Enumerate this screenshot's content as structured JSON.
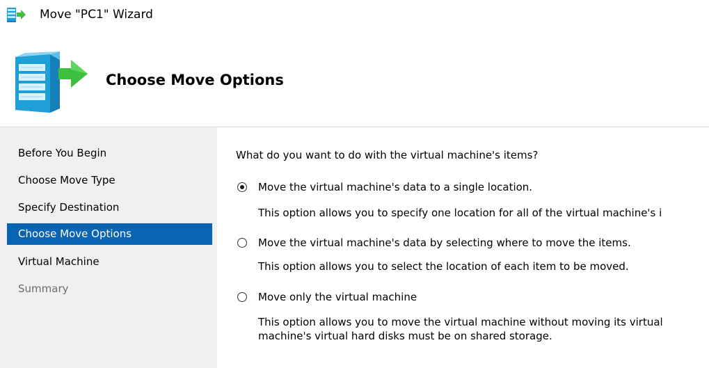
{
  "window": {
    "title": "Move \"PC1\" Wizard"
  },
  "header": {
    "title": "Choose Move Options"
  },
  "nav": {
    "items": [
      {
        "label": "Before You Begin",
        "state": "normal"
      },
      {
        "label": "Choose Move Type",
        "state": "normal"
      },
      {
        "label": "Specify Destination",
        "state": "normal"
      },
      {
        "label": "Choose Move Options",
        "state": "selected"
      },
      {
        "label": "Virtual Machine",
        "state": "normal"
      },
      {
        "label": "Summary",
        "state": "disabled"
      }
    ]
  },
  "content": {
    "question": "What do you want to do with the virtual machine's items?",
    "options": [
      {
        "label": "Move the virtual machine's data to a single location.",
        "description_line1": "This option allows you to specify one location for all of the virtual machine's i",
        "description_line2": "",
        "checked": true
      },
      {
        "label": "Move the virtual machine's data by selecting where to move the items.",
        "description_line1": "This option allows you to select the location of each item to be moved.",
        "description_line2": "",
        "checked": false
      },
      {
        "label": "Move only the virtual machine",
        "description_line1": "This option allows you to move the virtual machine without moving its virtual",
        "description_line2": "machine's virtual hard disks must be on shared storage.",
        "checked": false
      }
    ]
  },
  "icons": {
    "title_icon": "move-vm-small-icon",
    "header_icon": "move-vm-server-arrow-icon"
  },
  "colors": {
    "nav_background": "#f0f0f0",
    "nav_selected": "#0a64b4",
    "arrow_green": "#3fbf3f",
    "server_blue": "#1e9fd8"
  }
}
